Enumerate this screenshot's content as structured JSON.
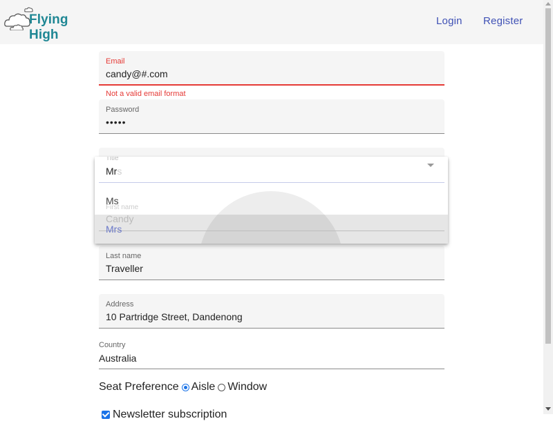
{
  "header": {
    "brand": "Flying High",
    "nav": {
      "login": "Login",
      "register": "Register"
    }
  },
  "form": {
    "email": {
      "label": "Email",
      "value": "candy@#.com",
      "error": "Not a valid email format"
    },
    "password": {
      "label": "Password",
      "value": "•••••"
    },
    "title": {
      "label": "Title",
      "value_typed": "Mr",
      "value_ghost": "s",
      "options": [
        "Ms",
        "Mrs"
      ],
      "selected": "Mrs"
    },
    "first_name": {
      "label": "First name",
      "value": "Candy"
    },
    "last_name": {
      "label": "Last name",
      "value": "Traveller"
    },
    "address": {
      "label": "Address",
      "value": "10 Partridge Street, Dandenong"
    },
    "country": {
      "label": "Country",
      "value": "Australia"
    },
    "seat_preference": {
      "label": "Seat Preference",
      "options": [
        "Aisle",
        "Window"
      ],
      "selected": "Aisle"
    },
    "newsletter": {
      "label": "Newsletter subscription",
      "checked": true
    }
  },
  "colors": {
    "brand": "#1f8794",
    "link": "#3f51b5",
    "error": "#e53935",
    "accent": "#1a73e8"
  },
  "icons": [
    "cloud-logo-icon",
    "dropdown-arrow-icon",
    "scroll-up-icon",
    "scroll-down-icon"
  ]
}
